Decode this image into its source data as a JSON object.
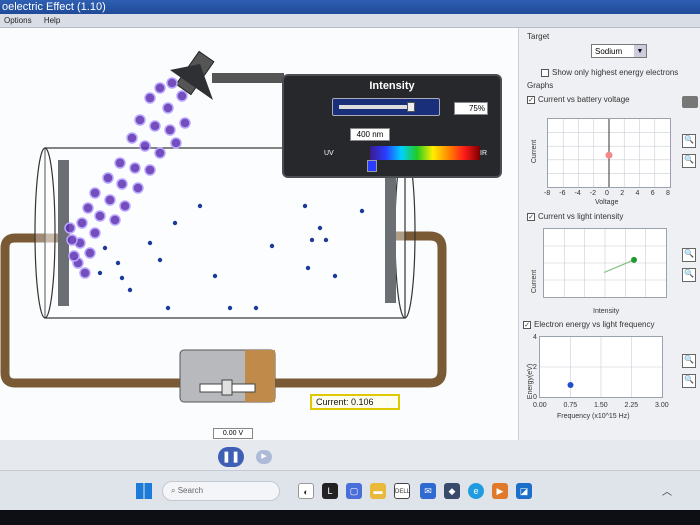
{
  "window": {
    "title": "oelectric Effect (1.10)"
  },
  "menu": {
    "options": "Options",
    "help": "Help"
  },
  "intensity": {
    "title": "Intensity",
    "percent": "75%",
    "level": 0.75,
    "wavelength": "400 nm",
    "uv_label": "UV",
    "ir_label": "IR"
  },
  "current": {
    "label": "Current:",
    "value": "0.106"
  },
  "battery": {
    "voltage": "0.00 V"
  },
  "target": {
    "label": "Target",
    "selected": "Sodium",
    "show_highest_label": "Show only highest energy electrons"
  },
  "graphs": {
    "label": "Graphs",
    "g1": {
      "title": "Current vs battery voltage",
      "ylabel": "Current",
      "xlabel": "Voltage",
      "ticks": [
        "-8",
        "-6",
        "-4",
        "-2",
        "0",
        "2",
        "4",
        "6",
        "8"
      ]
    },
    "g2": {
      "title": "Current vs light intensity",
      "ylabel": "Current",
      "xlabel": "Intensity"
    },
    "g3": {
      "title": "Electron energy vs light frequency",
      "ylabel": "Energy(eV)",
      "xlabel": "Frequency (x10^15 Hz)",
      "ticks": [
        "0.00",
        "0.75",
        "1.50",
        "2.25",
        "3.00"
      ],
      "yticks": [
        "4",
        "2",
        "0"
      ]
    }
  },
  "chart_data": [
    {
      "type": "scatter",
      "title": "Current vs battery voltage",
      "xlabel": "Voltage",
      "ylabel": "Current",
      "xlim": [
        -8,
        8
      ],
      "points": [
        {
          "x": 0,
          "y": 0.106
        }
      ],
      "grid": true
    },
    {
      "type": "line",
      "title": "Current vs light intensity",
      "xlabel": "Intensity",
      "ylabel": "Current",
      "points": [
        {
          "x": 0.5,
          "y": 0.07
        },
        {
          "x": 0.75,
          "y": 0.106
        }
      ]
    },
    {
      "type": "scatter",
      "title": "Electron energy vs light frequency",
      "xlabel": "Frequency (x10^15 Hz)",
      "ylabel": "Energy(eV)",
      "xlim": [
        0,
        3
      ],
      "ylim": [
        0,
        4
      ],
      "points": [
        {
          "x": 0.75,
          "y": 0.8
        }
      ]
    }
  ],
  "taskbar": {
    "search": "Search"
  },
  "colors": {
    "photon": "#5a2fb0",
    "electron": "#1b3a9a",
    "accent": "#e0c800",
    "point": "#1f9b2e",
    "marker": "#f28a8a"
  }
}
